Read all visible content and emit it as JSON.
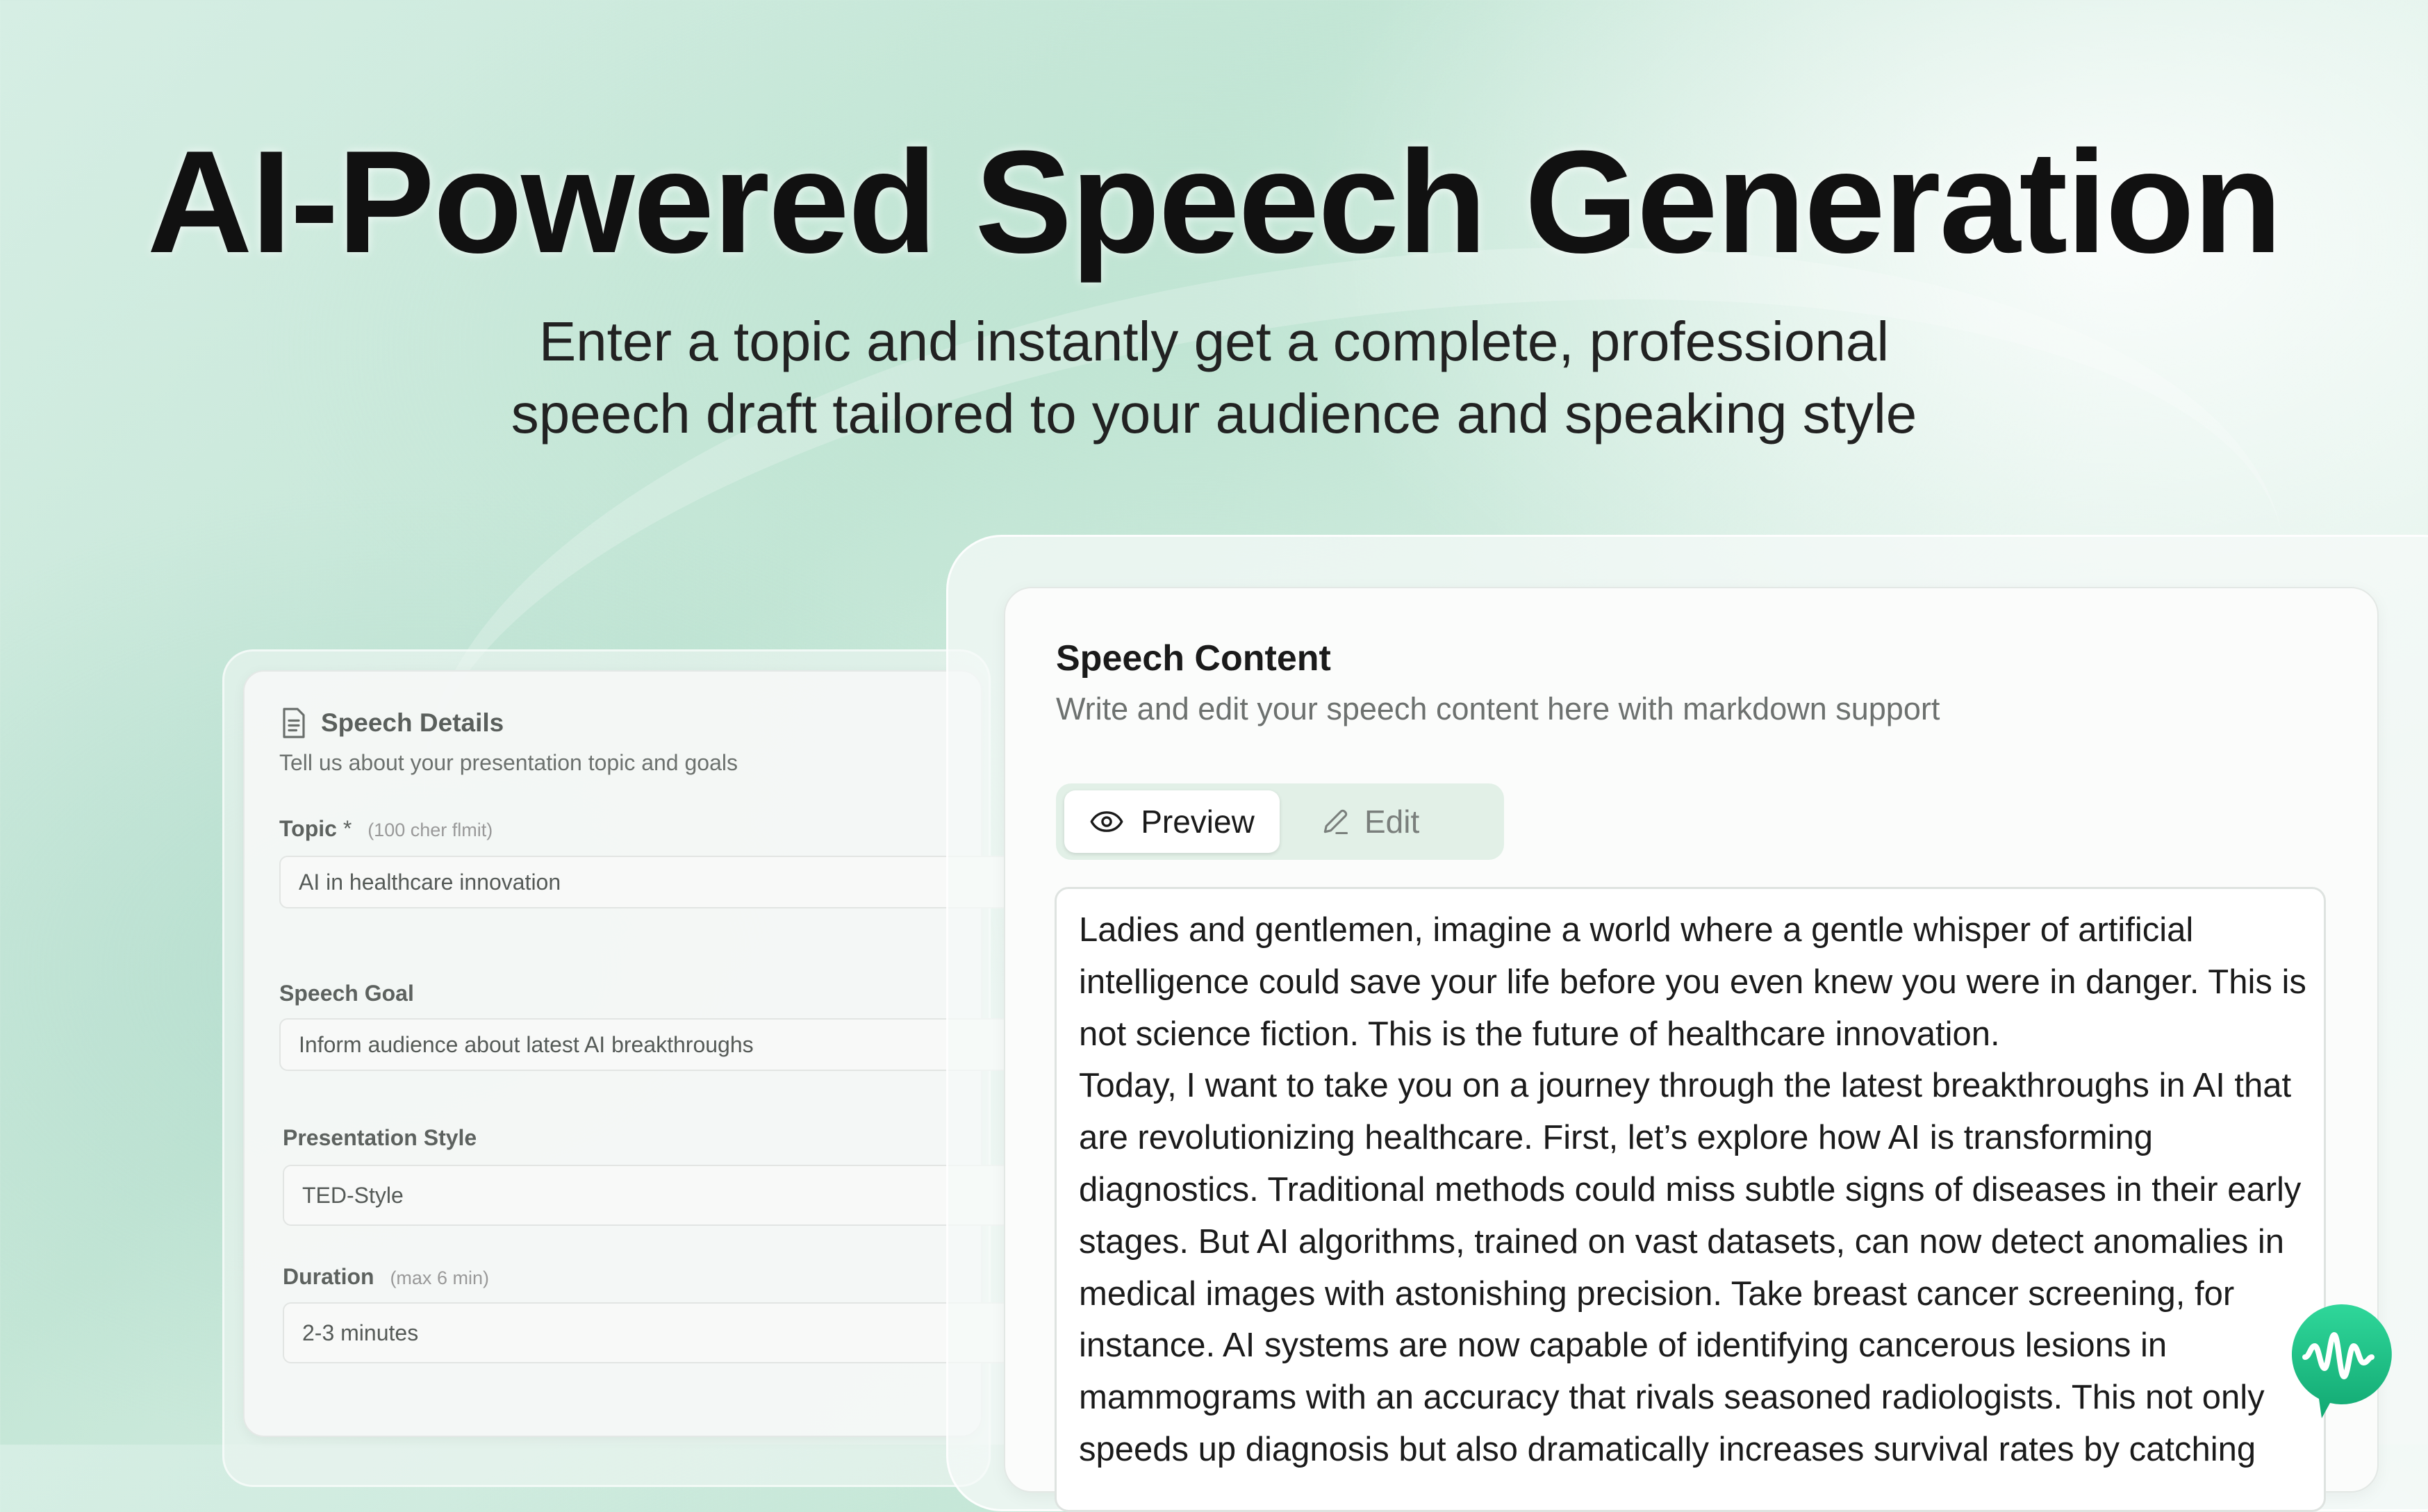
{
  "hero": {
    "title": "AI-Powered Speech Generation",
    "subtitle_line1": "Enter a topic and instantly get a complete, professional",
    "subtitle_line2": "speech draft tailored to your audience and speaking style"
  },
  "speech_details": {
    "icon": "document-icon",
    "title": "Speech Details",
    "description": "Tell us about your presentation topic and goals",
    "fields": [
      {
        "label": "Topic",
        "required_mark": "*",
        "hint": "(100 cher flmit)",
        "value": "AI in healthcare innovation"
      },
      {
        "label": "Speech Goal",
        "hint": "",
        "value": "Inform audience about latest AI breakthroughs"
      },
      {
        "label": "Presentation Style",
        "hint": "",
        "value": "TED-Style"
      },
      {
        "label": "Duration",
        "hint": "(max 6 min)",
        "value": "2-3 minutes"
      }
    ]
  },
  "speech_content": {
    "title": "Speech Content",
    "description": "Write and edit your speech content here with markdown support",
    "tabs": [
      {
        "label": "Preview",
        "icon": "eye-icon",
        "active": true
      },
      {
        "label": "Edit",
        "icon": "pencil-icon",
        "active": false
      }
    ],
    "paragraphs": [
      "Ladies and gentlemen, imagine a world where a gentle whisper of artificial intelligence could save your life before you even knew you were in danger. This is not science fiction. This is the future of healthcare innovation.",
      "Today, I want to take you on a journey through the latest breakthroughs in AI that are revolutionizing healthcare. First, let’s explore how AI is transforming diagnostics. Traditional methods could miss subtle signs of diseases in their early stages. But AI algorithms, trained on vast datasets, can now detect anomalies in medical images with astonishing precision. Take breast cancer screening, for instance. AI systems are now capable of identifying cancerous lesions in mammograms with an accuracy that rivals seasoned radiologists. This not only speeds up diagnosis but also dramatically increases survival rates by catching"
    ]
  },
  "brand": {
    "logo": "app-logo-icon",
    "accent": "#1fbf85"
  }
}
